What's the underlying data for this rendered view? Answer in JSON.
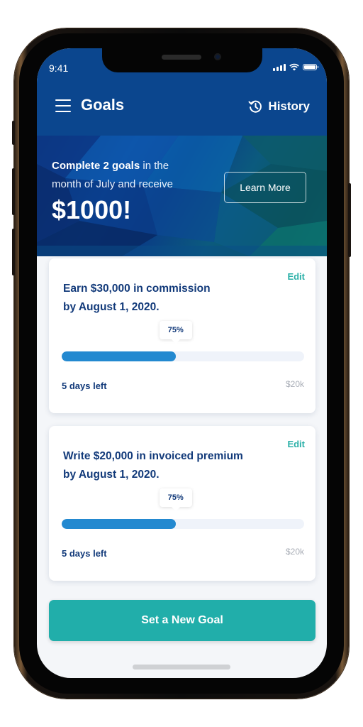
{
  "status_bar": {
    "time": "9:41"
  },
  "header": {
    "title": "Goals",
    "history_label": "History"
  },
  "banner": {
    "text_bold": "Complete 2 goals",
    "text_rest_line1": " in the",
    "text_line2": "month of July and receive",
    "amount": "$1000!",
    "button_label": "Learn More"
  },
  "goals": [
    {
      "title_line1": "Earn $30,000 in commission",
      "title_line2": "by August 1, 2020.",
      "edit_label": "Edit",
      "progress_label": "75%",
      "progress_fraction": 0.47,
      "days_left": "5 days left",
      "target": "$20k"
    },
    {
      "title_line1": "Write $20,000 in invoiced premium",
      "title_line2": "by August 1, 2020.",
      "edit_label": "Edit",
      "progress_label": "75%",
      "progress_fraction": 0.47,
      "days_left": "5 days left",
      "target": "$20k"
    }
  ],
  "actions": {
    "new_goal_label": "Set a New Goal"
  },
  "colors": {
    "header": "#0b468e",
    "accent_teal": "#21aeaa",
    "progress_blue": "#2389d0",
    "text_navy": "#123a7a"
  }
}
